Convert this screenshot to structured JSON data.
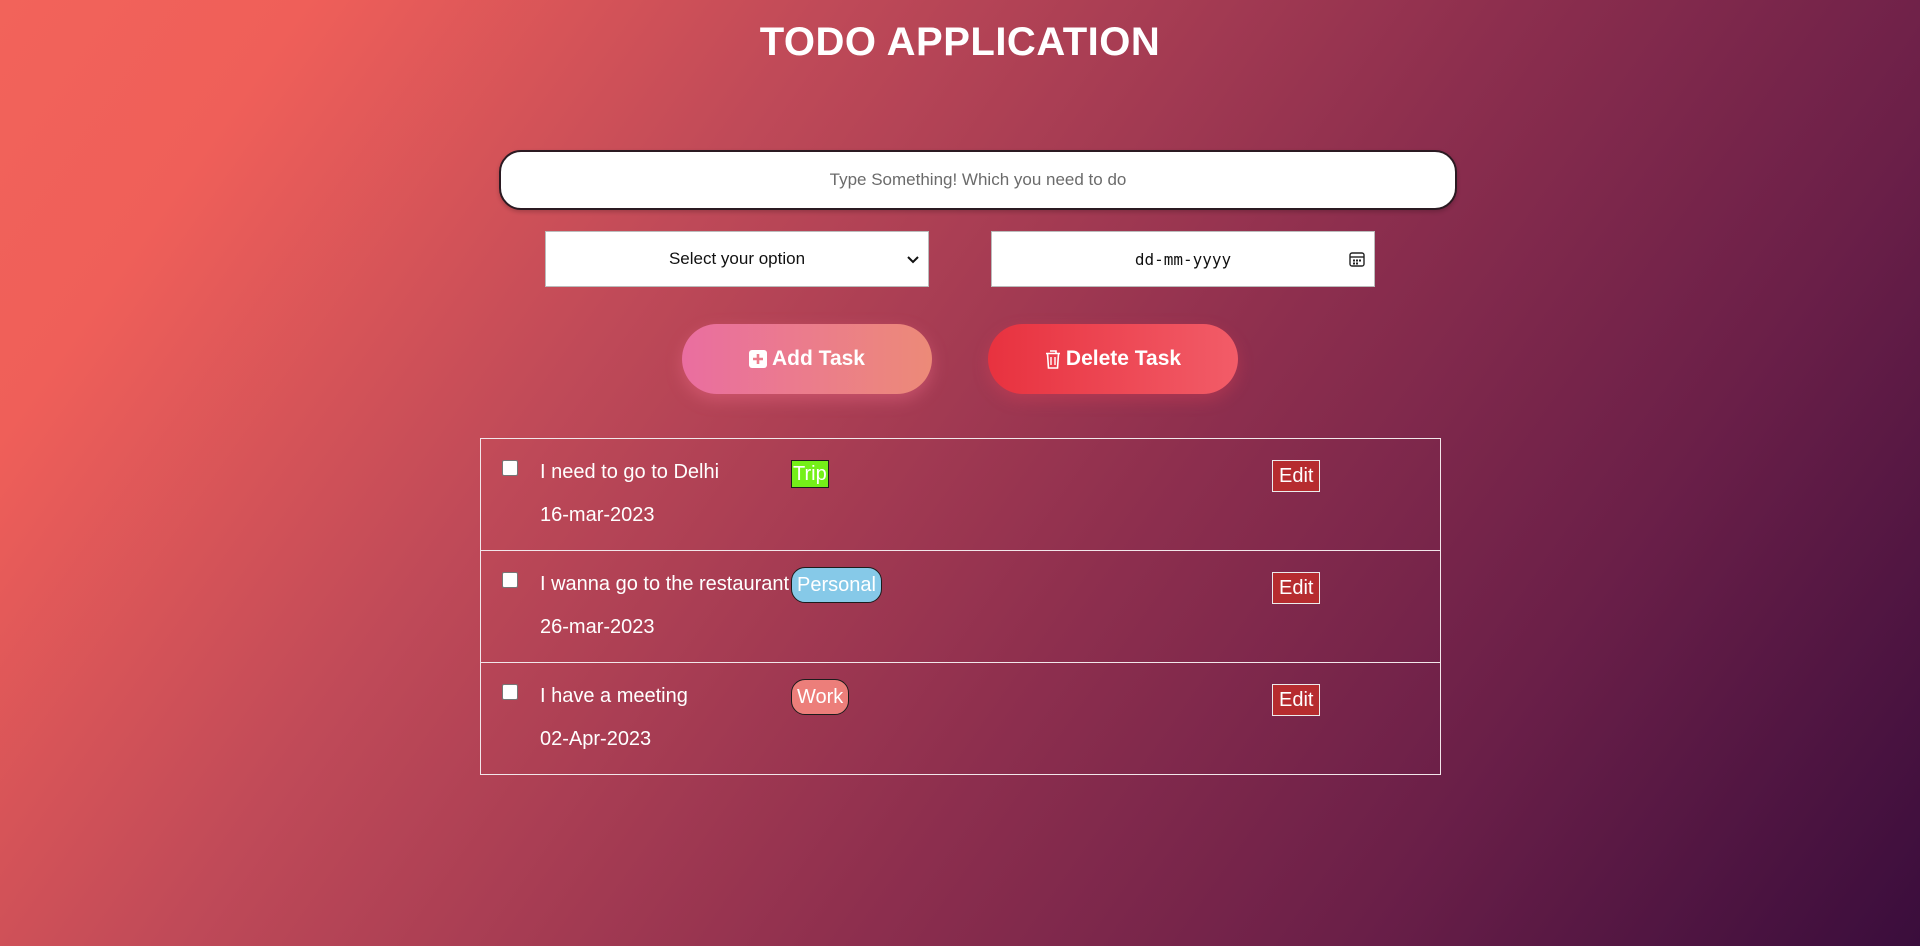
{
  "app": {
    "title": "TODO APPLICATION"
  },
  "form": {
    "task_placeholder": "Type Something! Which you need to do",
    "task_value": "",
    "select_value": "Select your option",
    "date_placeholder": "dd-mm-yyyy"
  },
  "actions": {
    "add_label": "Add Task",
    "delete_label": "Delete Task"
  },
  "tasks": [
    {
      "text": "I need to go to Delhi",
      "tag": "Trip",
      "date": "16-mar-2023",
      "edit_label": "Edit",
      "checked": false
    },
    {
      "text": "I wanna go to the restaurant",
      "tag": "Personal",
      "date": "26-mar-2023",
      "edit_label": "Edit",
      "checked": false
    },
    {
      "text": "I have a meeting",
      "tag": "Work",
      "date": "02-Apr-2023",
      "edit_label": "Edit",
      "checked": false
    }
  ],
  "colors": {
    "tag_trip": "#74f018",
    "tag_personal": "#86c9e8",
    "tag_work": "#ec7e7a",
    "edit_button": "#b62c2f",
    "add_button_start": "#ea6ea0",
    "delete_button_start": "#e8323f"
  },
  "icons": {
    "add": "plus-square-icon",
    "delete": "trash-icon",
    "select": "chevron-down-icon",
    "date": "calendar-icon"
  }
}
